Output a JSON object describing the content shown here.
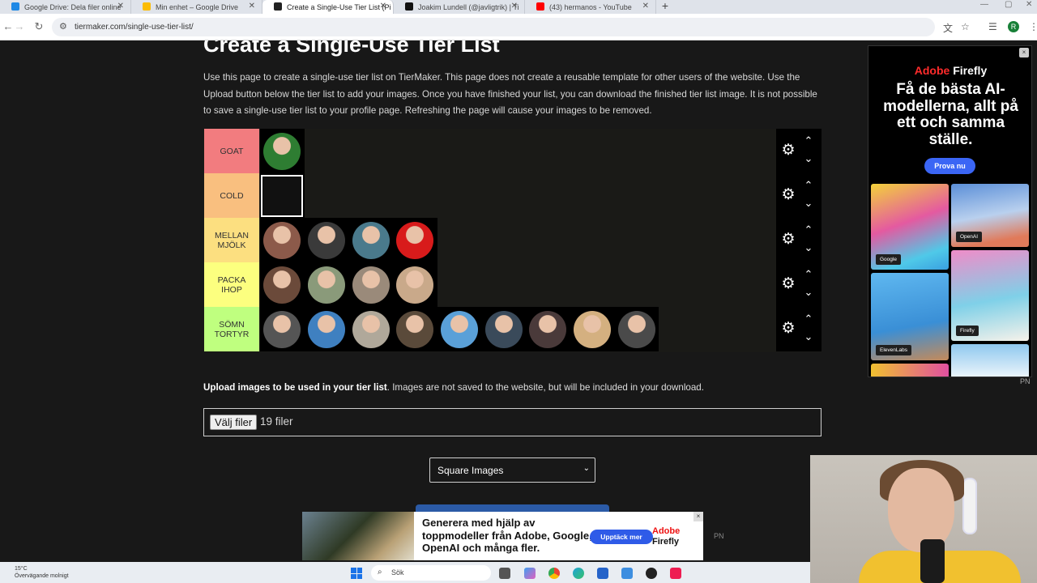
{
  "browser": {
    "tabs": [
      {
        "title": "Google Drive: Dela filer online",
        "active": false,
        "favicon_color": "#1e88e5"
      },
      {
        "title": "Min enhet – Google Drive",
        "active": false,
        "favicon_color": "#fbbc04"
      },
      {
        "title": "Create a Single-Use Tier List (Pi",
        "active": true,
        "favicon_color": "#222222"
      },
      {
        "title": "Joakim Lundell (@javligtrik) | Ti",
        "active": false,
        "favicon_color": "#111111"
      },
      {
        "title": "(43) hermanos - YouTube",
        "active": false,
        "favicon_color": "#ff0000"
      }
    ],
    "new_tab": "+",
    "url": "tiermaker.com/single-use-tier-list/",
    "profile_initial": "R"
  },
  "page": {
    "title": "Create a Single-Use Tier List",
    "intro": "Use this page to create a single-use tier list on TierMaker. This page does not create a reusable template for other users of the website. Use the Upload button below the tier list to add your images. Once you have finished your list, you can download the finished tier list image. It is not possible to save a single-use tier list to your profile page. Refreshing the page will cause your images to be removed.",
    "upload_bold": "Upload images to be used in your tier list",
    "upload_rest": ". Images are not saved to the website, but will be included in your download.",
    "file_button": "Välj filer",
    "file_count": "19 filer",
    "image_mode": "Square Images"
  },
  "tiers": [
    {
      "label": "GOAT",
      "color": "#f27c7f",
      "items": [
        "#2e7d32"
      ]
    },
    {
      "label": "COLD",
      "color": "#f9bf7f",
      "items": [
        "#ffffff"
      ]
    },
    {
      "label": "MELLAN MJÖLK",
      "color": "#fcdf80",
      "items": [
        "#8c5a4a",
        "#3a3a3a",
        "#4a7a8c",
        "#d81b1b"
      ]
    },
    {
      "label": "PACKA IHOP",
      "color": "#fcff7f",
      "items": [
        "#6b4a3a",
        "#8a9a7a",
        "#9a8a7a",
        "#c9a98a"
      ]
    },
    {
      "label": "SÖMN TORTYR",
      "color": "#bfff7f",
      "items": [
        "#555555",
        "#3f80c0",
        "#b0a89a",
        "#5a4a3a",
        "#5aa0d8",
        "#3a4a5a",
        "#4a3a3a",
        "#d4b080",
        "#4a4a4a"
      ]
    }
  ],
  "ad_right": {
    "brand_prefix": "Adobe",
    "brand_name": "Firefly",
    "headline": "Få de bästa AI-modellerna, allt på ett och samma ställe.",
    "cta": "Prova nu",
    "tags": [
      "Google",
      "OpenAI",
      "ElevenLabs",
      "Firefly"
    ],
    "info": "×",
    "pn": "PN"
  },
  "ad_bottom": {
    "text": "Generera med hjälp av toppmodeller från Adobe, Google, OpenAI och många fler.",
    "cta": "Upptäck mer",
    "brand_prefix": "Adobe",
    "brand_name": "Firefly",
    "info": "×",
    "pn": "PN"
  },
  "taskbar": {
    "temp": "15°C",
    "weather": "Övervägande molnigt",
    "search": "Sök"
  },
  "colors": {
    "page_bg": "#181818",
    "accent_blue": "#3b66f5",
    "adobe_red": "#ff2b2b"
  }
}
